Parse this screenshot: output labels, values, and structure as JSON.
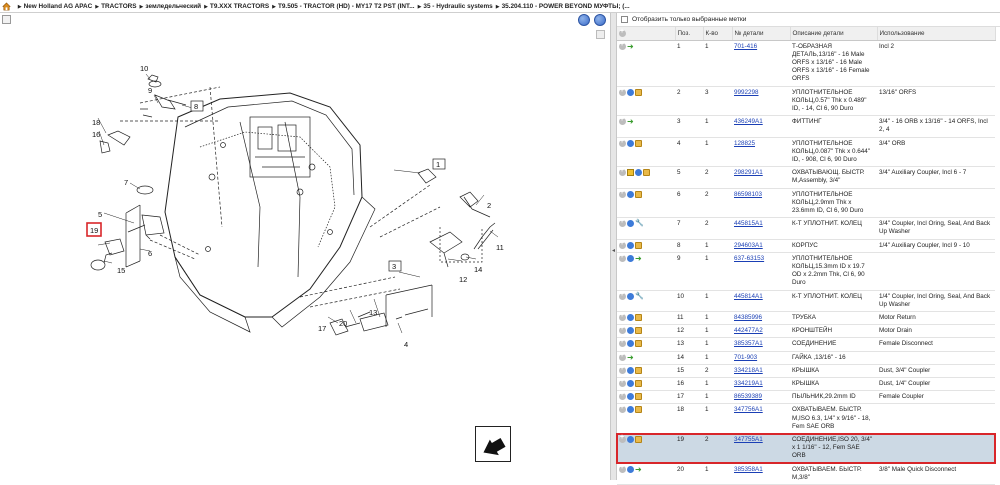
{
  "breadcrumb": [
    "New Holland AG APAC",
    "TRACTORS",
    "земледельческий",
    "T9.XXX TRACTORS",
    "T9.505 - TRACTOR (HD) - MY17 T2 PST (INT...",
    "35 - Hydraulic systems",
    "35.204.110 - POWER BEYOND МУФТЫ; (..."
  ],
  "filter": {
    "label": "Отобразить только выбранные метки"
  },
  "table": {
    "headers": [
      "",
      "Поз.",
      "К-во",
      "№ детали",
      "Описание детали",
      "Использование"
    ],
    "rows": [
      {
        "icons": [
          "plus",
          "arrow"
        ],
        "pos": "1",
        "qty": "1",
        "part": "701-416",
        "desc": "Т-ОБРАЗНАЯ ДЕТАЛЬ,13/16\" - 16 Male ORFS x 13/16\" - 16 Male ORFS x 13/16\" - 16 Female ORFS",
        "usage": "Incl 2"
      },
      {
        "icons": [
          "plus",
          "info",
          "box"
        ],
        "pos": "2",
        "qty": "3",
        "part": "9992298",
        "desc": "УПЛОТНИТЕЛЬНОЕ КОЛЬЦ,0.57\" Thk x 0.489\" ID, - 14, Cl 6, 90 Duro",
        "usage": "13/16\" ORFS"
      },
      {
        "icons": [
          "plus",
          "arrow"
        ],
        "pos": "3",
        "qty": "1",
        "part": "436249A1",
        "desc": "ФИТТИНГ",
        "usage": "3/4\" - 16 ORB x 13/16\" - 14 ORFS, Incl 2, 4"
      },
      {
        "icons": [
          "plus",
          "info",
          "box"
        ],
        "pos": "4",
        "qty": "1",
        "part": "128825",
        "desc": "УПЛОТНИТЕЛЬНОЕ КОЛЬЦ,0.087\" Thk x 0.644\" ID, - 908, Cl 6, 90 Duro",
        "usage": "3/4\" ORB"
      },
      {
        "icons": [
          "plus",
          "cart",
          "info",
          "box"
        ],
        "pos": "5",
        "qty": "2",
        "part": "298291A1",
        "desc": "ОХВАТЫВАЮЩ. БЫСТР. М,Assembly, 3/4\"",
        "usage": "3/4\" Auxiliary Coupler, Incl 6 - 7"
      },
      {
        "icons": [
          "plus",
          "info",
          "box"
        ],
        "pos": "6",
        "qty": "2",
        "part": "86598103",
        "desc": "УПЛОТНИТЕЛЬНОЕ КОЛЬЦ,2.9mm Thk x 23.6mm ID, Cl 6, 90 Duro",
        "usage": ""
      },
      {
        "icons": [
          "plus",
          "info",
          "wrench"
        ],
        "pos": "7",
        "qty": "2",
        "part": "445815A1",
        "desc": "К-Т УПЛОТНИТ. КОЛЕЦ",
        "usage": "3/4\" Coupler, Incl Oring, Seal, And Back Up Washer"
      },
      {
        "icons": [
          "plus",
          "info",
          "box"
        ],
        "pos": "8",
        "qty": "1",
        "part": "294603A1",
        "desc": "КОРПУС",
        "usage": "1/4\" Auxiliary Coupler, Incl 9 - 10"
      },
      {
        "icons": [
          "plus",
          "info",
          "arrow"
        ],
        "pos": "9",
        "qty": "1",
        "part": "637-63153",
        "desc": "УПЛОТНИТЕЛЬНОЕ КОЛЬЦ,15.3mm ID x 19.7 OD x 2.2mm Thk, Cl 6, 90 Duro",
        "usage": ""
      },
      {
        "icons": [
          "plus",
          "info",
          "wrench"
        ],
        "pos": "10",
        "qty": "1",
        "part": "445814A1",
        "desc": "К-Т УПЛОТНИТ. КОЛЕЦ",
        "usage": "1/4\" Coupler, Incl Oring, Seal, And Back Up Washer"
      },
      {
        "icons": [
          "plus",
          "info",
          "box"
        ],
        "pos": "11",
        "qty": "1",
        "part": "84385996",
        "desc": "ТРУБКА",
        "usage": "Motor Return"
      },
      {
        "icons": [
          "plus",
          "info",
          "box"
        ],
        "pos": "12",
        "qty": "1",
        "part": "442477A2",
        "desc": "КРОНШТЕЙН",
        "usage": "Motor Drain"
      },
      {
        "icons": [
          "plus",
          "info",
          "box"
        ],
        "pos": "13",
        "qty": "1",
        "part": "385357A1",
        "desc": "СОЕДИНЕНИЕ",
        "usage": "Female Disconnect"
      },
      {
        "icons": [
          "plus",
          "arrow"
        ],
        "pos": "14",
        "qty": "1",
        "part": "701-903",
        "desc": "ГАЙКА ,13/16\" - 16",
        "usage": ""
      },
      {
        "icons": [
          "plus",
          "info",
          "box"
        ],
        "pos": "15",
        "qty": "2",
        "part": "334218A1",
        "desc": "КРЫШКА",
        "usage": "Dust, 3/4\" Coupler"
      },
      {
        "icons": [
          "plus",
          "info",
          "box"
        ],
        "pos": "16",
        "qty": "1",
        "part": "334219A1",
        "desc": "КРЫШКА",
        "usage": "Dust, 1/4\" Coupler"
      },
      {
        "icons": [
          "plus",
          "info",
          "box"
        ],
        "pos": "17",
        "qty": "1",
        "part": "86539389",
        "desc": "ПЫЛЬНИК,29.2mm ID",
        "usage": "Female Coupler"
      },
      {
        "icons": [
          "plus",
          "info",
          "box"
        ],
        "pos": "18",
        "qty": "1",
        "part": "347756A1",
        "desc": "ОХВАТЫВАЕМ. БЫСТР. М,ISO 6.3, 1/4\" x 9/16\" - 18, Fem SAE ORB",
        "usage": ""
      },
      {
        "icons": [
          "plus",
          "info",
          "box"
        ],
        "pos": "19",
        "qty": "2",
        "part": "347755A1",
        "desc": "СОЕДИНЕНИЕ,ISO 20, 3/4\" x 1 1/16\" - 12, Fem SAE ORB",
        "usage": "",
        "selected": true
      },
      {
        "icons": [
          "plus",
          "info",
          "arrow"
        ],
        "pos": "20",
        "qty": "1",
        "part": "385358A1",
        "desc": "ОХВАТЫВАЕМ. БЫСТР. М,3/8\"",
        "usage": "3/8\" Male Quick Disconnect"
      }
    ]
  },
  "diagram": {
    "callouts": [
      "1",
      "2",
      "3",
      "4",
      "5",
      "6",
      "7",
      "8",
      "9",
      "10",
      "11",
      "12",
      "13",
      "14",
      "15",
      "16",
      "17",
      "18",
      "19",
      "20"
    ],
    "highlight_color": "#d8262a"
  }
}
